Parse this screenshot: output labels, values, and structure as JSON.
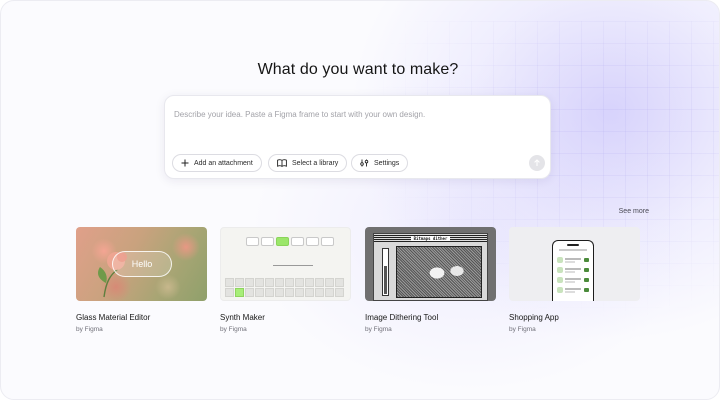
{
  "headline": "What do you want to make?",
  "prompt": {
    "placeholder": "Describe your idea. Paste a Figma frame to start with your own design.",
    "value": "",
    "actions": [
      {
        "label": "Add an attachment",
        "icon": "plus-icon"
      },
      {
        "label": "Select a library",
        "icon": "book-icon"
      },
      {
        "label": "Settings",
        "icon": "sliders-icon"
      }
    ],
    "send_icon": "arrow-up-icon"
  },
  "see_more": "See more",
  "templates": [
    {
      "title": "Glass Material Editor",
      "author": "by Figma",
      "thumb_text": "Hello"
    },
    {
      "title": "Synth Maker",
      "author": "by Figma"
    },
    {
      "title": "Image Dithering Tool",
      "author": "by Figma",
      "thumb_text": "Bitmaps dither"
    },
    {
      "title": "Shopping App",
      "author": "by Figma"
    }
  ],
  "colors": {
    "accent_glow": "#bab2fa",
    "synth_active": "#9be66a",
    "shop_tag": "#4b8b3b"
  }
}
